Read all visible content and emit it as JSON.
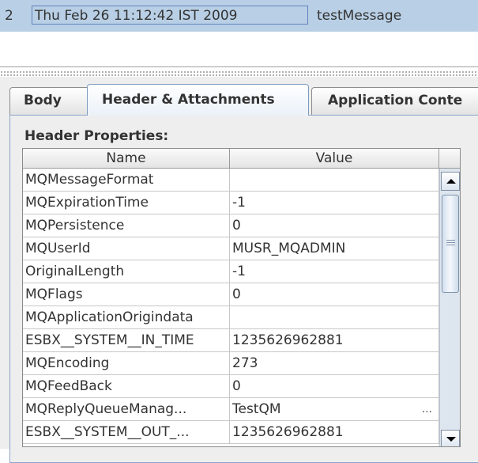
{
  "message_row": {
    "number": "2",
    "date": "Thu Feb 26 11:12:42 IST 2009",
    "text": "testMessage"
  },
  "tabs": [
    {
      "label": "Body",
      "selected": false
    },
    {
      "label": "Header & Attachments",
      "selected": true
    },
    {
      "label": "Application Conte",
      "selected": false
    }
  ],
  "section_title": "Header Properties:",
  "table": {
    "columns": [
      "Name",
      "Value"
    ],
    "rows": [
      {
        "name": "MQMessageFormat",
        "value": ""
      },
      {
        "name": "MQExpirationTime",
        "value": "-1"
      },
      {
        "name": "MQPersistence",
        "value": "0"
      },
      {
        "name": "MQUserId",
        "value": "MUSR_MQADMIN"
      },
      {
        "name": "OriginalLength",
        "value": "-1"
      },
      {
        "name": "MQFlags",
        "value": "0"
      },
      {
        "name": "MQApplicationOrigindata",
        "value": ""
      },
      {
        "name": "ESBX__SYSTEM__IN_TIME",
        "value": "1235626962881"
      },
      {
        "name": "MQEncoding",
        "value": "273"
      },
      {
        "name": "MQFeedBack",
        "value": "0"
      },
      {
        "name": "MQReplyQueueManag...",
        "value": "TestQM",
        "ellipsis": "..."
      },
      {
        "name": "ESBX__SYSTEM__OUT_...",
        "value": "1235626962881"
      }
    ]
  },
  "colors": {
    "selection": "#b8cfe5",
    "accent_border": "#8aa6c9",
    "panel": "#eeeeee"
  },
  "icons": {
    "scroll_up": "triangle-up-icon",
    "scroll_down": "triangle-down-icon",
    "thumb_grip": "grip-icon"
  }
}
